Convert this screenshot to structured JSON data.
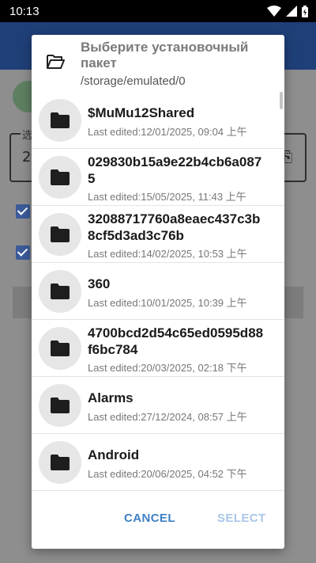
{
  "status_bar": {
    "time": "10:13",
    "icons": [
      "wifi-icon",
      "cellular-signal-icon",
      "battery-charging-icon"
    ]
  },
  "background": {
    "field_label": "选",
    "field_value": "2"
  },
  "dialog": {
    "title": "Выберите установочный пакет",
    "path": "/storage/emulated/0",
    "header_icon": "folder-open-icon",
    "items": [
      {
        "name": "$MuMu12Shared",
        "edited": "Last edited:12/01/2025, 09:04 上午"
      },
      {
        "name": "029830b15a9e22b4cb6a0875",
        "edited": "Last edited:15/05/2025, 11:43 上午"
      },
      {
        "name": "32088717760a8eaec437c3b8cf5d3ad3c76b",
        "edited": "Last edited:14/02/2025, 10:53 上午"
      },
      {
        "name": "360",
        "edited": "Last edited:10/01/2025, 10:39 上午"
      },
      {
        "name": "4700bcd2d54c65ed0595d88f6bc784",
        "edited": "Last edited:20/03/2025, 02:18 下午"
      },
      {
        "name": "Alarms",
        "edited": "Last edited:27/12/2024, 08:57 上午"
      },
      {
        "name": "Android",
        "edited": "Last edited:20/06/2025, 04:52 下午"
      }
    ],
    "cancel_label": "CANCEL",
    "select_label": "SELECT"
  },
  "colors": {
    "accent": "#3f7fc6",
    "accent_disabled": "#a9c6e8",
    "app_bar": "#1f3f78"
  }
}
